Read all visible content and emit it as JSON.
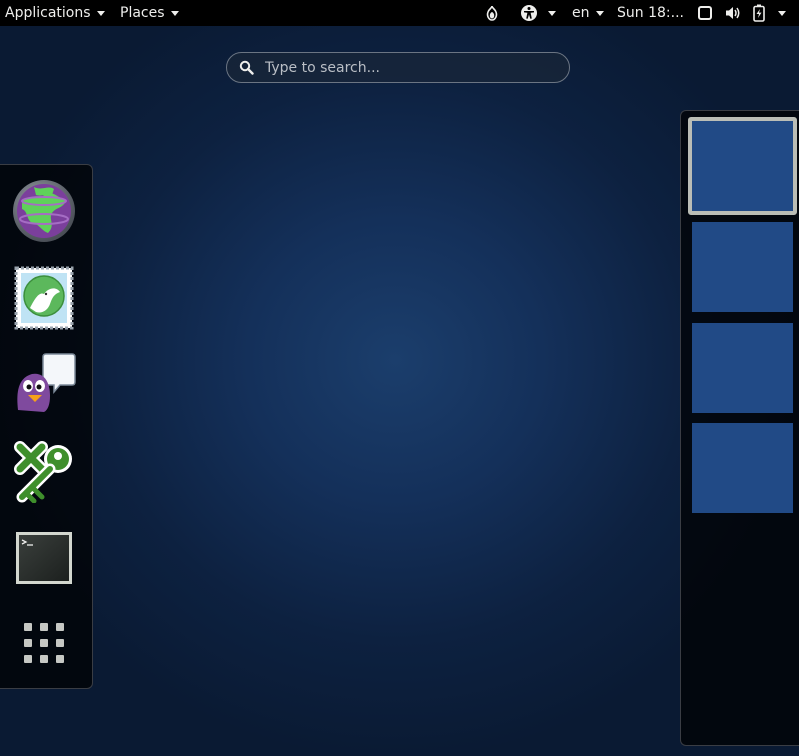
{
  "topbar": {
    "applications_label": "Applications",
    "places_label": "Places",
    "language": "en",
    "clock": "Sun 18:..."
  },
  "search": {
    "placeholder": "Type to search..."
  },
  "dash": {
    "apps": [
      {
        "name": "Tor Browser",
        "icon": "tor-globe-icon"
      },
      {
        "name": "Mail",
        "icon": "mail-dove-icon"
      },
      {
        "name": "Pidgin",
        "icon": "pidgin-icon"
      },
      {
        "name": "KeePassX",
        "icon": "keepassx-key-icon"
      },
      {
        "name": "Terminal",
        "icon": "terminal-icon"
      }
    ],
    "show_apps_icon": "show-applications-grid-icon"
  },
  "workspaces": {
    "count": 4,
    "active_index": 0
  },
  "colors": {
    "topbar_bg": "#000000",
    "workspace_fill": "#214a86",
    "workspace_active_border": "#babdb6"
  }
}
